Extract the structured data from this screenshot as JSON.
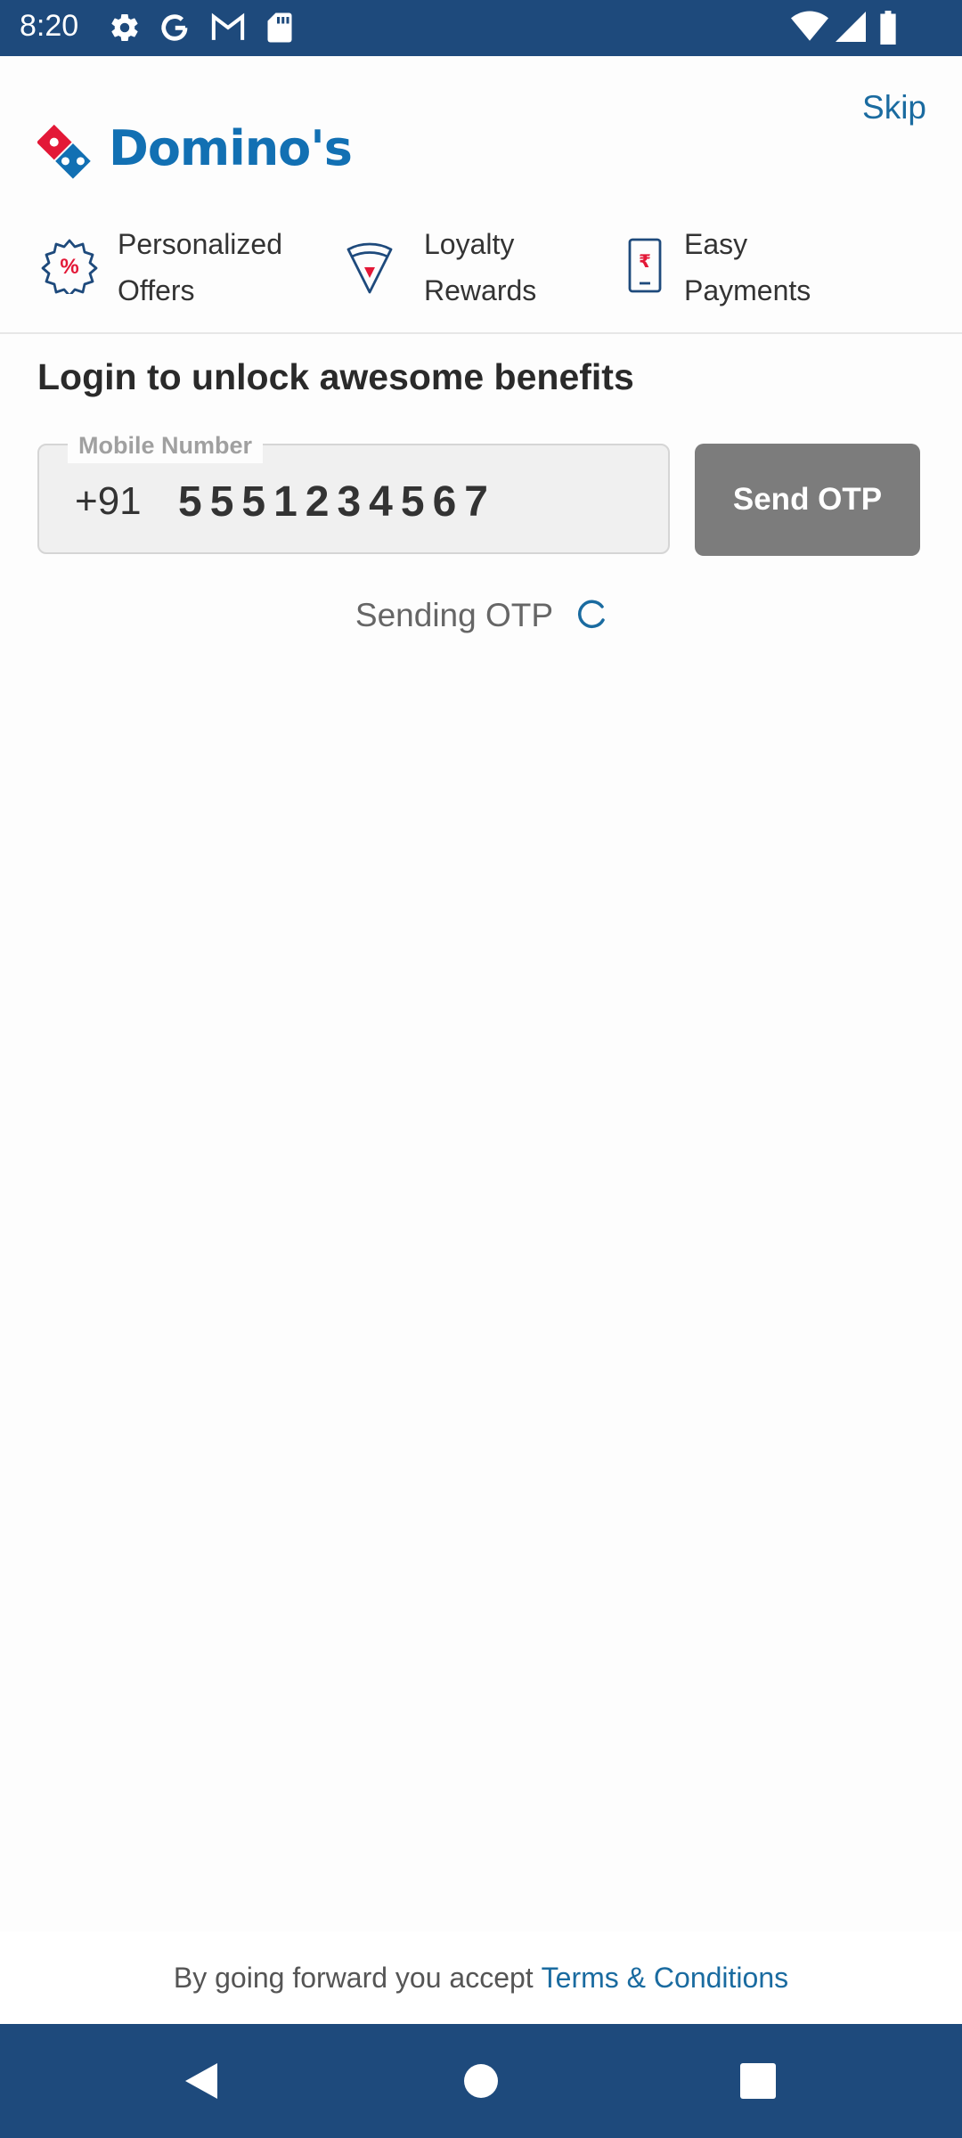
{
  "status_bar": {
    "time": "8:20",
    "left_icons": [
      "gear-icon",
      "google-g-icon",
      "gmail-icon",
      "sd-card-icon"
    ],
    "right_icons": [
      "wifi-icon",
      "signal-icon",
      "battery-icon"
    ]
  },
  "header": {
    "skip_label": "Skip",
    "brand_name": "Domino's"
  },
  "benefits": [
    {
      "icon": "offer-badge-icon",
      "line1": "Personalized",
      "line2": "Offers"
    },
    {
      "icon": "pizza-slice-icon",
      "line1": "Loyalty",
      "line2": "Rewards"
    },
    {
      "icon": "phone-rupee-icon",
      "line1": "Easy",
      "line2": "Payments"
    }
  ],
  "login": {
    "heading": "Login to unlock awesome benefits",
    "field_label": "Mobile Number",
    "country_code": "+91",
    "phone_value": "5551234567",
    "send_otp_label": "Send OTP",
    "status_text": "Sending OTP"
  },
  "footer": {
    "prefix": "By going forward you accept",
    "terms_link": "Terms & Conditions"
  },
  "colors": {
    "brand_blue": "#1270b3",
    "brand_red": "#e31837",
    "bar_blue": "#1e4a7c",
    "link_blue": "#1a6ba0",
    "button_disabled": "#7c7c7c"
  }
}
